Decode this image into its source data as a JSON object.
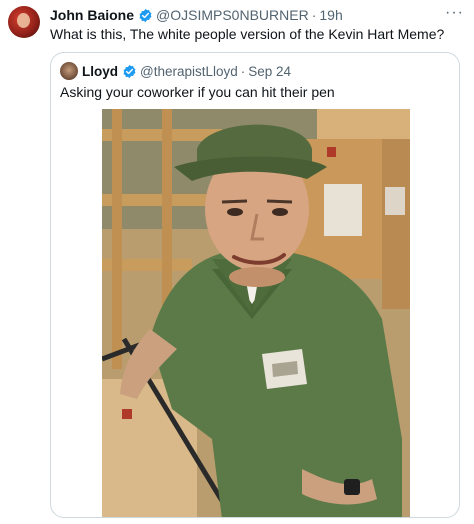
{
  "tweet": {
    "author_name": "John Baione",
    "handle": "@OJSIMPS0NBURNER",
    "separator": "·",
    "time": "19h",
    "more_icon": "more-horizontal-icon",
    "more_label": "···",
    "text": "What is this, The white people version of the Kevin Hart Meme?"
  },
  "quoted": {
    "author_name": "Lloyd",
    "handle": "@therapistLloyd",
    "separator": "·",
    "date": "Sep 24",
    "text": "Asking your coworker if you can hit their pen"
  },
  "colors": {
    "verified": "#1d9bf0",
    "text": "#0f1419",
    "muted": "#536471",
    "border": "#cfd9de"
  }
}
